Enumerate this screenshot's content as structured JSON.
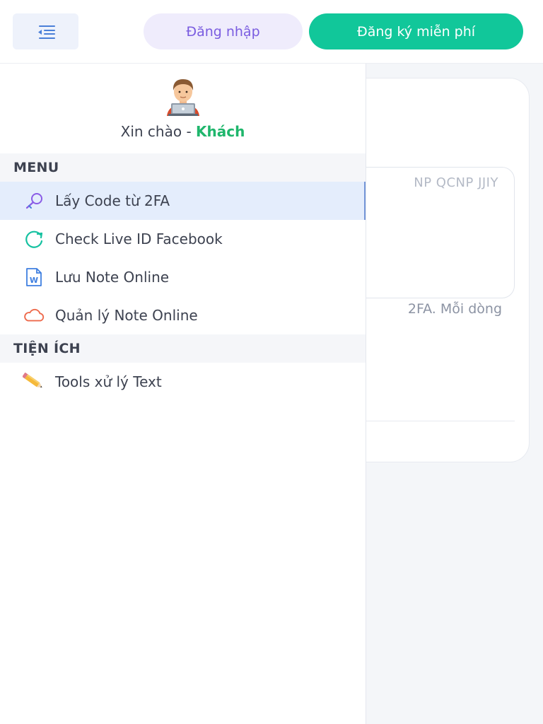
{
  "header": {
    "login_label": "Đăng nhập",
    "register_label": "Đăng ký miễn phí",
    "accent_login": "#7a5ce0",
    "accent_register": "#11c79a"
  },
  "background": {
    "placeholder_fragment": "NP QCNP JJIY",
    "hint_fragment": "2FA. Mỗi dòng"
  },
  "drawer": {
    "greeting_prefix": "Xin chào - ",
    "greeting_name": "Khách",
    "sections": [
      {
        "title": "MENU",
        "items": [
          {
            "label": "Lấy Code từ 2FA",
            "icon": "key-search-icon",
            "active": true
          },
          {
            "label": "Check Live ID Facebook",
            "icon": "refresh-icon",
            "active": false
          },
          {
            "label": "Lưu Note Online",
            "icon": "word-document-icon",
            "active": false
          },
          {
            "label": "Quản lý Note Online",
            "icon": "cloud-icon",
            "active": false
          }
        ]
      },
      {
        "title": "TIỆN ÍCH",
        "items": [
          {
            "label": "Tools xử lý Text",
            "icon": "pencil-icon",
            "active": false
          }
        ]
      }
    ]
  }
}
